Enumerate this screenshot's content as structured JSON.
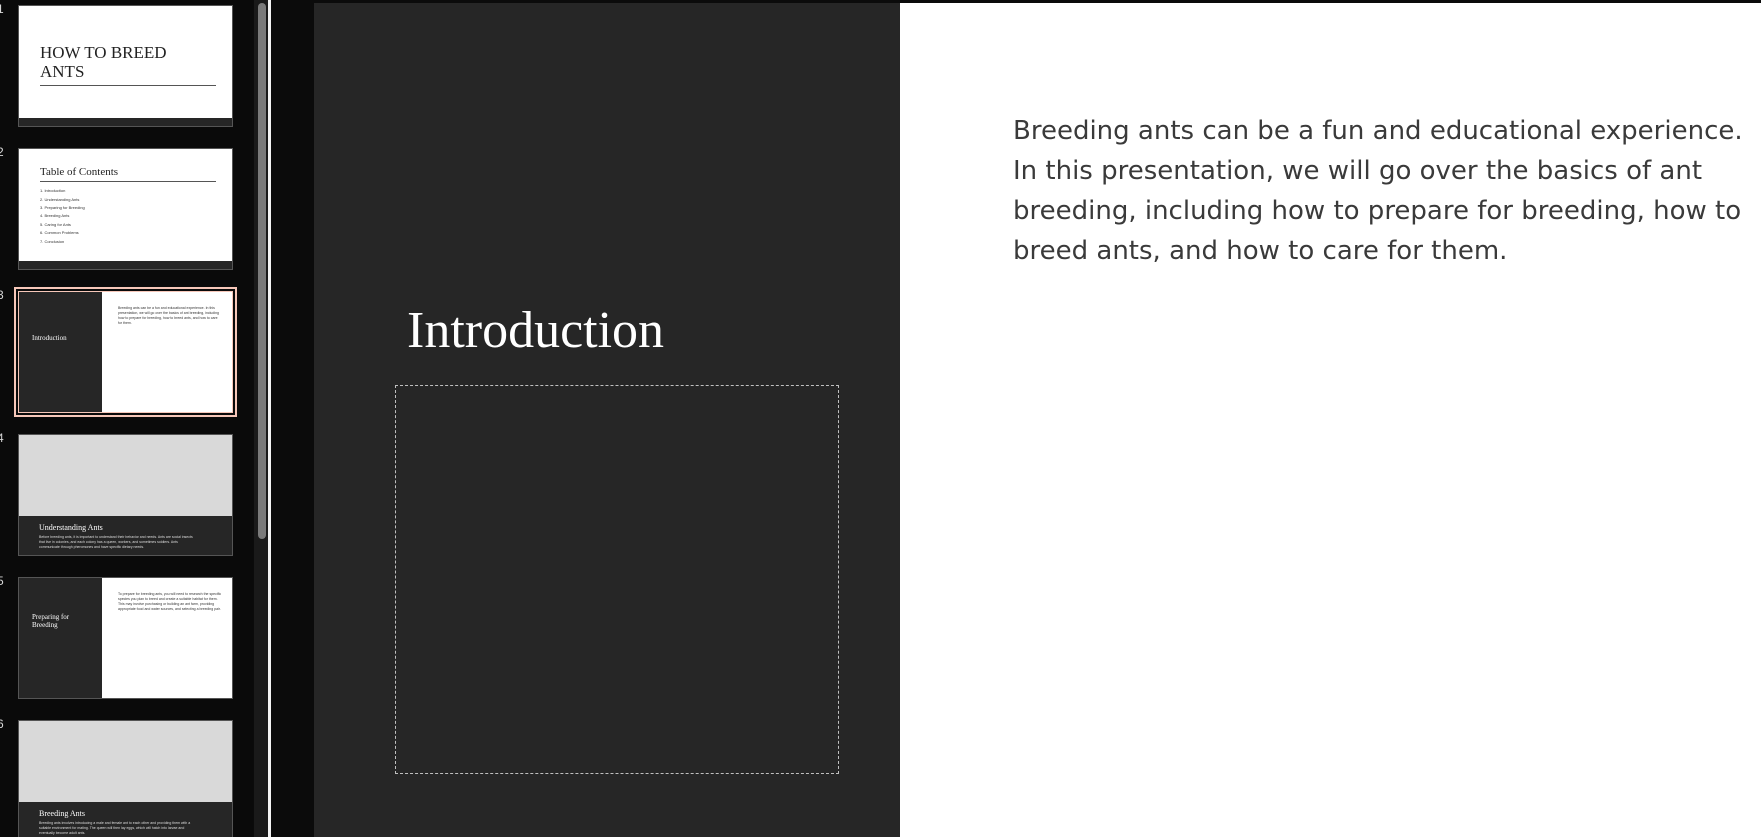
{
  "thumbnails": [
    {
      "number": "1",
      "title": "HOW TO BREED ANTS"
    },
    {
      "number": "2",
      "title": "Table of Contents",
      "items": [
        "1. Introduction",
        "2. Understanding Ants",
        "3. Preparing for Breeding",
        "4. Breeding Ants",
        "5. Caring for Ants",
        "6. Common Problems",
        "7. Conclusion"
      ]
    },
    {
      "number": "3",
      "title": "Introduction",
      "body": "Breeding ants can be a fun and educational experience. In this presentation, we will go over the basics of ant breeding, including how to prepare for breeding, how to breed ants, and how to care for them."
    },
    {
      "number": "4",
      "title": "Understanding Ants",
      "body": "Before breeding ants, it is important to understand their behavior and needs. Ants are social insects that live in colonies, and each colony has a queen, workers, and sometimes soldiers. Ants communicate through pheromones and have specific dietary needs."
    },
    {
      "number": "5",
      "title": "Preparing for Breeding",
      "body": "To prepare for breeding ants, you will need to research the specific species you plan to breed and create a suitable habitat for them. This may involve purchasing or building an ant farm, providing appropriate food and water sources, and selecting a breeding pair."
    },
    {
      "number": "6",
      "title": "Breeding Ants",
      "body": "Breeding ants involves introducing a male and female ant to each other and providing them with a suitable environment for mating. The queen will then lay eggs, which will hatch into larvae and eventually become adult ants."
    }
  ],
  "slide": {
    "title": "Introduction",
    "body": "Breeding ants can be a fun and educational experience. In this presentation, we will go over the basics of ant breeding, including how to prepare for breeding, how to breed ants, and how to care for them."
  }
}
